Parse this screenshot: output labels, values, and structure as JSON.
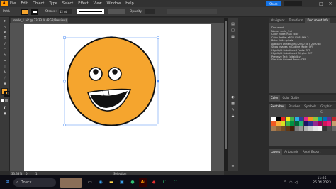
{
  "app": {
    "logo": "Ai"
  },
  "menu": [
    "File",
    "Edit",
    "Object",
    "Type",
    "Select",
    "Effect",
    "View",
    "Window",
    "Help"
  ],
  "window_controls": {
    "minimize": "—",
    "maximize": "□",
    "close": "✕"
  },
  "share": {
    "label": "Share"
  },
  "control_bar": {
    "selection_label": "Path",
    "stroke_label": "Stroke:",
    "stroke_value": "12 pt",
    "opacity_label": "Opacity:"
  },
  "document_tab": {
    "label": "smile_1.ai* @ 33,33 % (RGB/Preview)",
    "close": "×"
  },
  "colors": {
    "fill": "#f5a52e",
    "stroke": "#1a1a1a",
    "accent": "#1473e6"
  },
  "right_panel": {
    "top_tabs": [
      "Navigator",
      "Transform",
      "Document Info"
    ],
    "info_lines": [
      "Document",
      "Name: smile_1.ai",
      "",
      "Color Mode: RGB color",
      "Color Profile: sRGB IEC61966-2.1",
      "Ruler Units: pixels",
      "Artboard Dimensions: 2000 px x 2000 px",
      "Show Images In Outline Mode: OFF",
      "Highlight Substituted Fonts: OFF",
      "Highlight Substituted Glyphs: OFF",
      "Preserve Text Editability",
      "Simulate Colored Paper: OFF"
    ],
    "middle_tabs": [
      "Color",
      "Color Guide"
    ],
    "swatches_tabs": [
      "Swatches",
      "Brushes",
      "Symbols",
      "Graphic S"
    ],
    "layers_tabs": [
      "Layers",
      "Artboards",
      "Asset Export"
    ]
  },
  "status_bar": {
    "zoom": "33,33%",
    "rotation": "0°",
    "page": "1",
    "tool": "Selection"
  },
  "taskbar": {
    "search_label": "Поиск",
    "time": "11:26",
    "date": "26.04.2023"
  }
}
